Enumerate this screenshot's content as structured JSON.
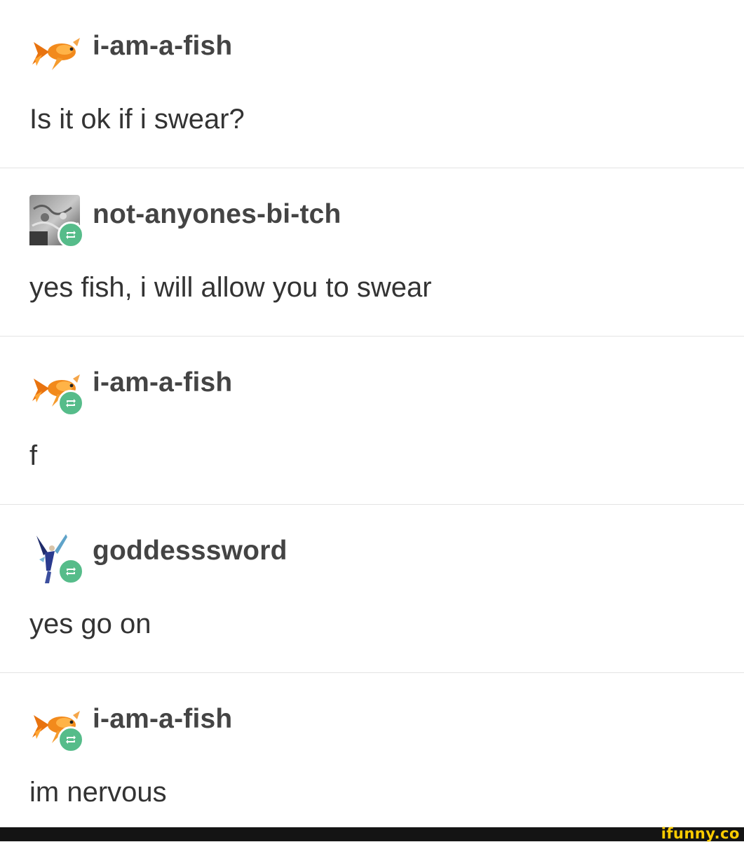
{
  "posts": [
    {
      "username": "i-am-a-fish",
      "text": "Is it ok if i swear?",
      "avatar": "goldfish-avatar",
      "reblog": false
    },
    {
      "username": "not-anyones-bi-tch",
      "text": "yes fish, i will allow you to swear",
      "avatar": "grey-texture-avatar",
      "reblog": true
    },
    {
      "username": "i-am-a-fish",
      "text": "f",
      "avatar": "goldfish-avatar",
      "reblog": true
    },
    {
      "username": "goddesssword",
      "text": "yes go on",
      "avatar": "figure-avatar",
      "reblog": true
    },
    {
      "username": "i-am-a-fish",
      "text": "im nervous",
      "avatar": "goldfish-avatar",
      "reblog": true
    }
  ],
  "footer": {
    "watermark": "ifunny.co"
  },
  "colors": {
    "reblog_badge": "#56bc8a",
    "footer_bg": "#141414",
    "watermark": "#ffcc00"
  }
}
